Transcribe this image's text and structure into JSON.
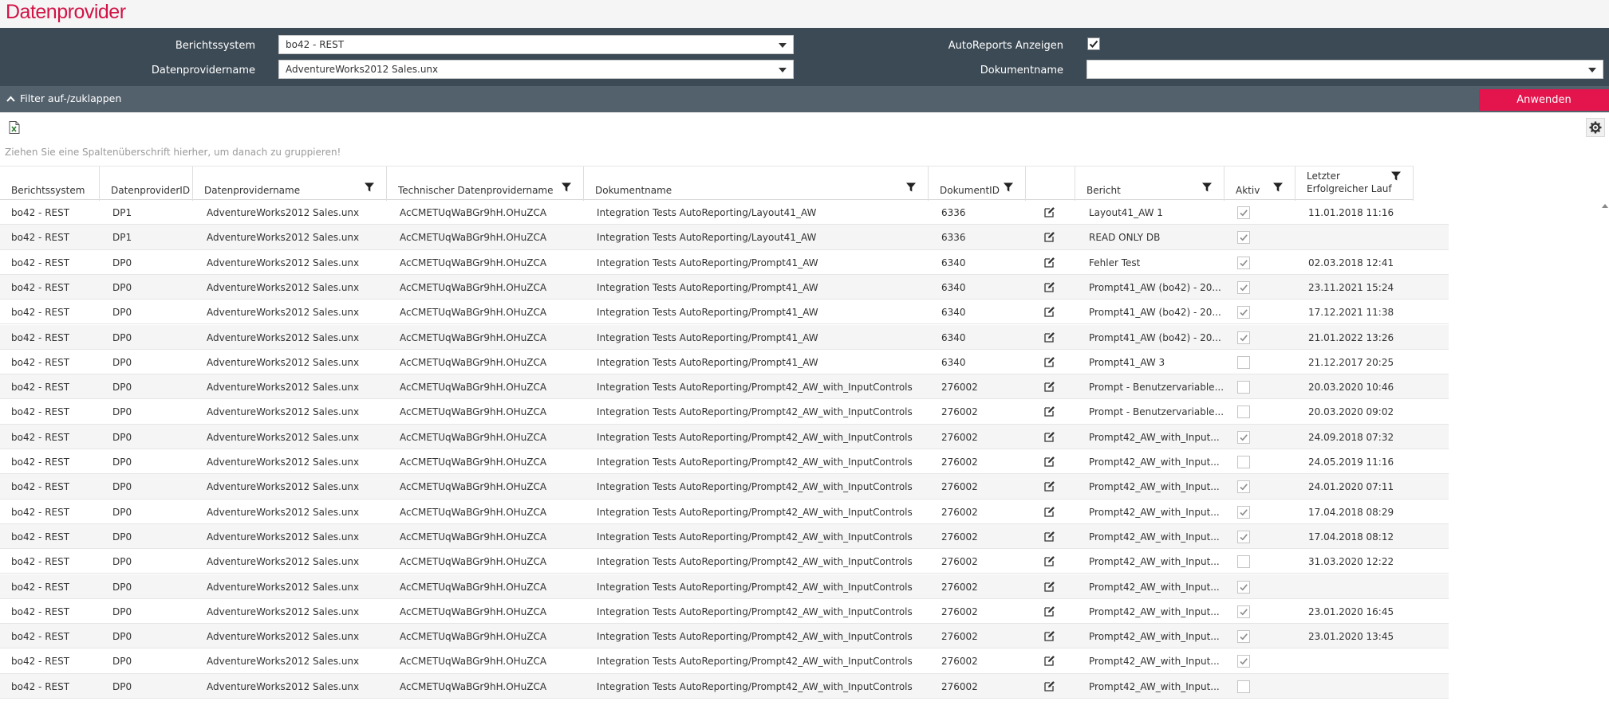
{
  "app": {
    "title": "Datenprovider"
  },
  "filters": {
    "berichtssystem_label": "Berichtssystem",
    "berichtssystem_value": "bo42 - REST",
    "datenprovidername_label": "Datenprovidername",
    "datenprovidername_value": "AdventureWorks2012 Sales.unx",
    "autoreports_label": "AutoReports Anzeigen",
    "autoreports_checked": true,
    "dokumentname_label": "Dokumentname",
    "dokumentname_value": ""
  },
  "toolbar": {
    "toggle_label": "Filter auf-/zuklappen",
    "apply_label": "Anwenden",
    "group_hint": "Ziehen Sie eine Spaltenüberschrift hierher, um danach zu gruppieren!"
  },
  "icons": {
    "excel": "excel-export-icon",
    "settings": "gear-icon",
    "filter": "funnel-icon",
    "edit": "edit-icon",
    "collapse": "chevron-up-icon"
  },
  "colors": {
    "brand": "#d01446",
    "apply": "#e4144d",
    "panel": "#3c4a55",
    "toggle_bar": "#53616c"
  },
  "grid": {
    "columns": [
      "Berichtssystem",
      "DatenproviderID",
      "Datenprovidername",
      "Technischer Datenprovidername",
      "Dokumentname",
      "DokumentID",
      "",
      "Bericht",
      "Aktiv",
      "Letzter Erfolgreicher Lauf"
    ],
    "last_run_header_line1": "Letzter",
    "last_run_header_line2": "Erfolgreicher Lauf",
    "rows": [
      {
        "system": "bo42 - REST",
        "dpid": "DP1",
        "dpname": "AdventureWorks2012 Sales.unx",
        "tech": "AcCMETUqWaBGr9hH.OHuZCA",
        "doc": "Integration Tests AutoReporting/Layout41_AW",
        "docid": "6336",
        "report": "Layout41_AW 1",
        "active": true,
        "last": "11.01.2018 11:16"
      },
      {
        "system": "bo42 - REST",
        "dpid": "DP1",
        "dpname": "AdventureWorks2012 Sales.unx",
        "tech": "AcCMETUqWaBGr9hH.OHuZCA",
        "doc": "Integration Tests AutoReporting/Layout41_AW",
        "docid": "6336",
        "report": "READ ONLY DB",
        "active": true,
        "last": ""
      },
      {
        "system": "bo42 - REST",
        "dpid": "DP0",
        "dpname": "AdventureWorks2012 Sales.unx",
        "tech": "AcCMETUqWaBGr9hH.OHuZCA",
        "doc": "Integration Tests AutoReporting/Prompt41_AW",
        "docid": "6340",
        "report": "Fehler Test",
        "active": true,
        "last": "02.03.2018 12:41"
      },
      {
        "system": "bo42 - REST",
        "dpid": "DP0",
        "dpname": "AdventureWorks2012 Sales.unx",
        "tech": "AcCMETUqWaBGr9hH.OHuZCA",
        "doc": "Integration Tests AutoReporting/Prompt41_AW",
        "docid": "6340",
        "report": "Prompt41_AW (bo42) - 20...",
        "active": true,
        "last": "23.11.2021 15:24"
      },
      {
        "system": "bo42 - REST",
        "dpid": "DP0",
        "dpname": "AdventureWorks2012 Sales.unx",
        "tech": "AcCMETUqWaBGr9hH.OHuZCA",
        "doc": "Integration Tests AutoReporting/Prompt41_AW",
        "docid": "6340",
        "report": "Prompt41_AW (bo42) - 20...",
        "active": true,
        "last": "17.12.2021 11:38"
      },
      {
        "system": "bo42 - REST",
        "dpid": "DP0",
        "dpname": "AdventureWorks2012 Sales.unx",
        "tech": "AcCMETUqWaBGr9hH.OHuZCA",
        "doc": "Integration Tests AutoReporting/Prompt41_AW",
        "docid": "6340",
        "report": "Prompt41_AW (bo42) - 20...",
        "active": true,
        "last": "21.01.2022 13:26"
      },
      {
        "system": "bo42 - REST",
        "dpid": "DP0",
        "dpname": "AdventureWorks2012 Sales.unx",
        "tech": "AcCMETUqWaBGr9hH.OHuZCA",
        "doc": "Integration Tests AutoReporting/Prompt41_AW",
        "docid": "6340",
        "report": "Prompt41_AW 3",
        "active": false,
        "last": "21.12.2017 20:25"
      },
      {
        "system": "bo42 - REST",
        "dpid": "DP0",
        "dpname": "AdventureWorks2012 Sales.unx",
        "tech": "AcCMETUqWaBGr9hH.OHuZCA",
        "doc": "Integration Tests AutoReporting/Prompt42_AW_with_InputControls",
        "docid": "276002",
        "report": "Prompt - Benutzervariable...",
        "active": false,
        "last": "20.03.2020 10:46"
      },
      {
        "system": "bo42 - REST",
        "dpid": "DP0",
        "dpname": "AdventureWorks2012 Sales.unx",
        "tech": "AcCMETUqWaBGr9hH.OHuZCA",
        "doc": "Integration Tests AutoReporting/Prompt42_AW_with_InputControls",
        "docid": "276002",
        "report": "Prompt - Benutzervariable...",
        "active": false,
        "last": "20.03.2020 09:02"
      },
      {
        "system": "bo42 - REST",
        "dpid": "DP0",
        "dpname": "AdventureWorks2012 Sales.unx",
        "tech": "AcCMETUqWaBGr9hH.OHuZCA",
        "doc": "Integration Tests AutoReporting/Prompt42_AW_with_InputControls",
        "docid": "276002",
        "report": "Prompt42_AW_with_Input...",
        "active": true,
        "last": "24.09.2018 07:32"
      },
      {
        "system": "bo42 - REST",
        "dpid": "DP0",
        "dpname": "AdventureWorks2012 Sales.unx",
        "tech": "AcCMETUqWaBGr9hH.OHuZCA",
        "doc": "Integration Tests AutoReporting/Prompt42_AW_with_InputControls",
        "docid": "276002",
        "report": "Prompt42_AW_with_Input...",
        "active": false,
        "last": "24.05.2019 11:16"
      },
      {
        "system": "bo42 - REST",
        "dpid": "DP0",
        "dpname": "AdventureWorks2012 Sales.unx",
        "tech": "AcCMETUqWaBGr9hH.OHuZCA",
        "doc": "Integration Tests AutoReporting/Prompt42_AW_with_InputControls",
        "docid": "276002",
        "report": "Prompt42_AW_with_Input...",
        "active": true,
        "last": "24.01.2020 07:11"
      },
      {
        "system": "bo42 - REST",
        "dpid": "DP0",
        "dpname": "AdventureWorks2012 Sales.unx",
        "tech": "AcCMETUqWaBGr9hH.OHuZCA",
        "doc": "Integration Tests AutoReporting/Prompt42_AW_with_InputControls",
        "docid": "276002",
        "report": "Prompt42_AW_with_Input...",
        "active": true,
        "last": "17.04.2018 08:29"
      },
      {
        "system": "bo42 - REST",
        "dpid": "DP0",
        "dpname": "AdventureWorks2012 Sales.unx",
        "tech": "AcCMETUqWaBGr9hH.OHuZCA",
        "doc": "Integration Tests AutoReporting/Prompt42_AW_with_InputControls",
        "docid": "276002",
        "report": "Prompt42_AW_with_Input...",
        "active": true,
        "last": "17.04.2018 08:12"
      },
      {
        "system": "bo42 - REST",
        "dpid": "DP0",
        "dpname": "AdventureWorks2012 Sales.unx",
        "tech": "AcCMETUqWaBGr9hH.OHuZCA",
        "doc": "Integration Tests AutoReporting/Prompt42_AW_with_InputControls",
        "docid": "276002",
        "report": "Prompt42_AW_with_Input...",
        "active": false,
        "last": "31.03.2020 12:22"
      },
      {
        "system": "bo42 - REST",
        "dpid": "DP0",
        "dpname": "AdventureWorks2012 Sales.unx",
        "tech": "AcCMETUqWaBGr9hH.OHuZCA",
        "doc": "Integration Tests AutoReporting/Prompt42_AW_with_InputControls",
        "docid": "276002",
        "report": "Prompt42_AW_with_Input...",
        "active": true,
        "last": ""
      },
      {
        "system": "bo42 - REST",
        "dpid": "DP0",
        "dpname": "AdventureWorks2012 Sales.unx",
        "tech": "AcCMETUqWaBGr9hH.OHuZCA",
        "doc": "Integration Tests AutoReporting/Prompt42_AW_with_InputControls",
        "docid": "276002",
        "report": "Prompt42_AW_with_Input...",
        "active": true,
        "last": "23.01.2020 16:45"
      },
      {
        "system": "bo42 - REST",
        "dpid": "DP0",
        "dpname": "AdventureWorks2012 Sales.unx",
        "tech": "AcCMETUqWaBGr9hH.OHuZCA",
        "doc": "Integration Tests AutoReporting/Prompt42_AW_with_InputControls",
        "docid": "276002",
        "report": "Prompt42_AW_with_Input...",
        "active": true,
        "last": "23.01.2020 13:45"
      },
      {
        "system": "bo42 - REST",
        "dpid": "DP0",
        "dpname": "AdventureWorks2012 Sales.unx",
        "tech": "AcCMETUqWaBGr9hH.OHuZCA",
        "doc": "Integration Tests AutoReporting/Prompt42_AW_with_InputControls",
        "docid": "276002",
        "report": "Prompt42_AW_with_Input...",
        "active": true,
        "last": ""
      },
      {
        "system": "bo42 - REST",
        "dpid": "DP0",
        "dpname": "AdventureWorks2012 Sales.unx",
        "tech": "AcCMETUqWaBGr9hH.OHuZCA",
        "doc": "Integration Tests AutoReporting/Prompt42_AW_with_InputControls",
        "docid": "276002",
        "report": "Prompt42_AW_with_Input...",
        "active": false,
        "last": ""
      }
    ]
  }
}
